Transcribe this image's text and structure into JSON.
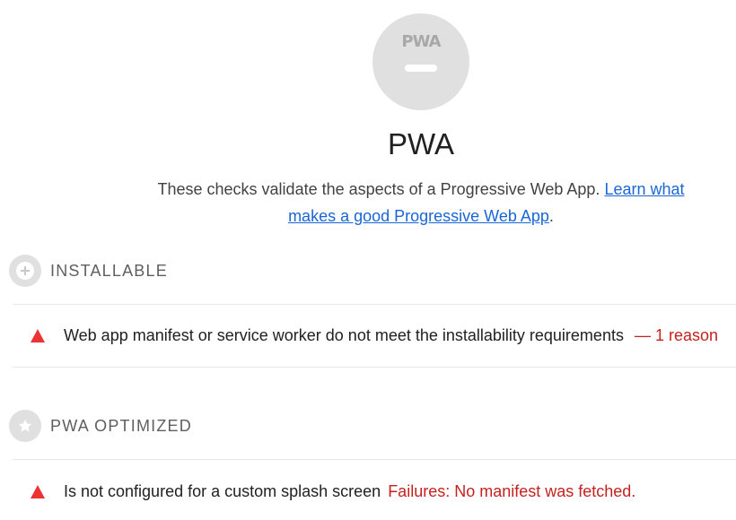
{
  "category": {
    "gauge_logo": "PWA",
    "title": "PWA",
    "description": "These checks validate the aspects of a Progressive Web App. ",
    "learn_more_link": "Learn what makes a good Progressive Web App",
    "description_end": "."
  },
  "groups": [
    {
      "title": "INSTALLABLE",
      "icon": "plus-circle-icon",
      "audits": [
        {
          "status": "fail",
          "title": "Web app manifest or service worker do not meet the installability requirements",
          "extra": "— 1 reason"
        }
      ]
    },
    {
      "title": "PWA OPTIMIZED",
      "icon": "star-icon",
      "audits": [
        {
          "status": "fail",
          "title": "Is not configured for a custom splash screen",
          "extra": "Failures: No manifest was fetched."
        }
      ]
    }
  ],
  "colors": {
    "fail": "#eb3333",
    "link": "#1a66d6",
    "gauge": "#e0e0e0"
  }
}
